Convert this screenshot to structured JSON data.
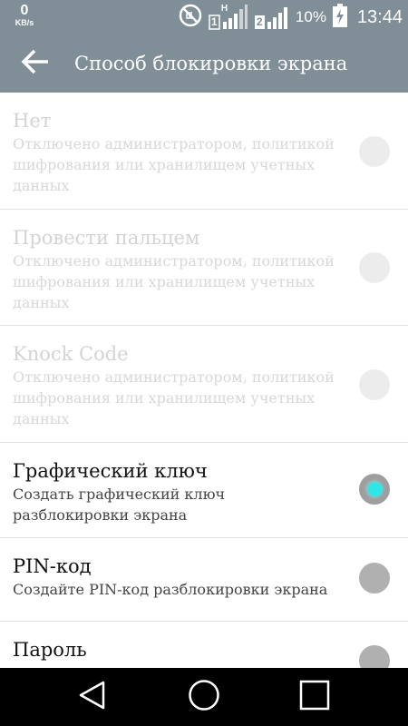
{
  "status_bar": {
    "speed_value": "0",
    "speed_unit": "KB/s",
    "sim1_label": "1",
    "sim1_net": "H",
    "sim2_label": "2",
    "battery_percent": "10%",
    "time": "13:44",
    "icons": [
      "do-not-disturb-icon",
      "signal-sim1-icon",
      "signal-sim2-icon",
      "battery-charging-icon"
    ]
  },
  "toolbar": {
    "back_icon": "back-arrow-icon",
    "title": "Способ блокировки экрана",
    "background": "#808e98"
  },
  "options": [
    {
      "key": "none",
      "title": "Нет",
      "subtitle": "Отключено администратором, политикой шифрования или хранилищем учетных данных",
      "enabled": false,
      "selected": false
    },
    {
      "key": "swipe",
      "title": "Провести пальцем",
      "subtitle": "Отключено администратором, политикой шифрования или хранилищем учетных данных",
      "enabled": false,
      "selected": false
    },
    {
      "key": "knock_code",
      "title": "Knock Code",
      "subtitle": "Отключено администратором, политикой шифрования или хранилищем учетных данных",
      "enabled": false,
      "selected": false
    },
    {
      "key": "pattern",
      "title": "Графический ключ",
      "subtitle": "Создать графический ключ разблокировки экрана",
      "enabled": true,
      "selected": true
    },
    {
      "key": "pin",
      "title": "PIN-код",
      "subtitle": "Создайте PIN-код разблокировки экрана",
      "enabled": true,
      "selected": false
    },
    {
      "key": "password",
      "title": "Пароль",
      "subtitle": "",
      "enabled": true,
      "selected": false
    }
  ],
  "colors": {
    "accent": "#2ee6e6",
    "disabled_text": "#d4d4d4",
    "navbar": "#000000"
  },
  "nav_bar": {
    "icons": [
      "back-triangle-icon",
      "home-circle-icon",
      "recents-square-icon"
    ]
  }
}
